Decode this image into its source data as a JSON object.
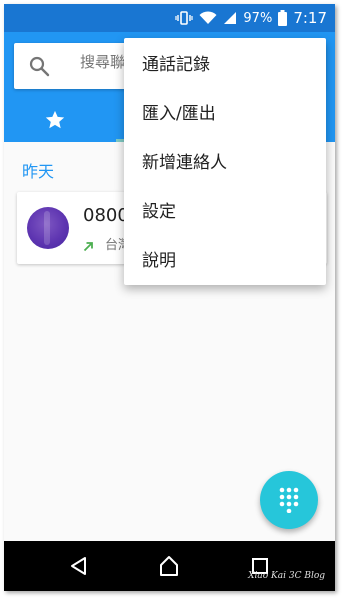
{
  "status_bar": {
    "battery_percent": "97%",
    "time": "7:17",
    "icons": [
      "vibrate-icon",
      "wifi-icon",
      "signal-icon",
      "battery-icon"
    ]
  },
  "search": {
    "placeholder": "搜尋聯絡人"
  },
  "tabs": [
    {
      "icon": "star-icon",
      "name": "speed-dial"
    }
  ],
  "call_log": {
    "section_header": "昨天",
    "entries": [
      {
        "number": "0800",
        "location": "台灣",
        "call_type_icon": "outgoing-call-icon"
      }
    ]
  },
  "overflow_menu": {
    "items": [
      "通話記錄",
      "匯入/匯出",
      "新增連絡人",
      "設定",
      "說明"
    ]
  },
  "fab": {
    "icon": "dialpad-icon"
  },
  "nav_bar": {
    "icons": [
      "back-icon",
      "home-icon",
      "recents-icon"
    ]
  },
  "watermark": "Xiao Kai 3C Blog",
  "colors": {
    "app_bar": "#2196f3",
    "status_bar": "#1976d2",
    "fab": "#26c6da",
    "accent_text": "#2196f3",
    "outgoing_arrow": "#4caf50",
    "avatar": "#5e35b1"
  }
}
